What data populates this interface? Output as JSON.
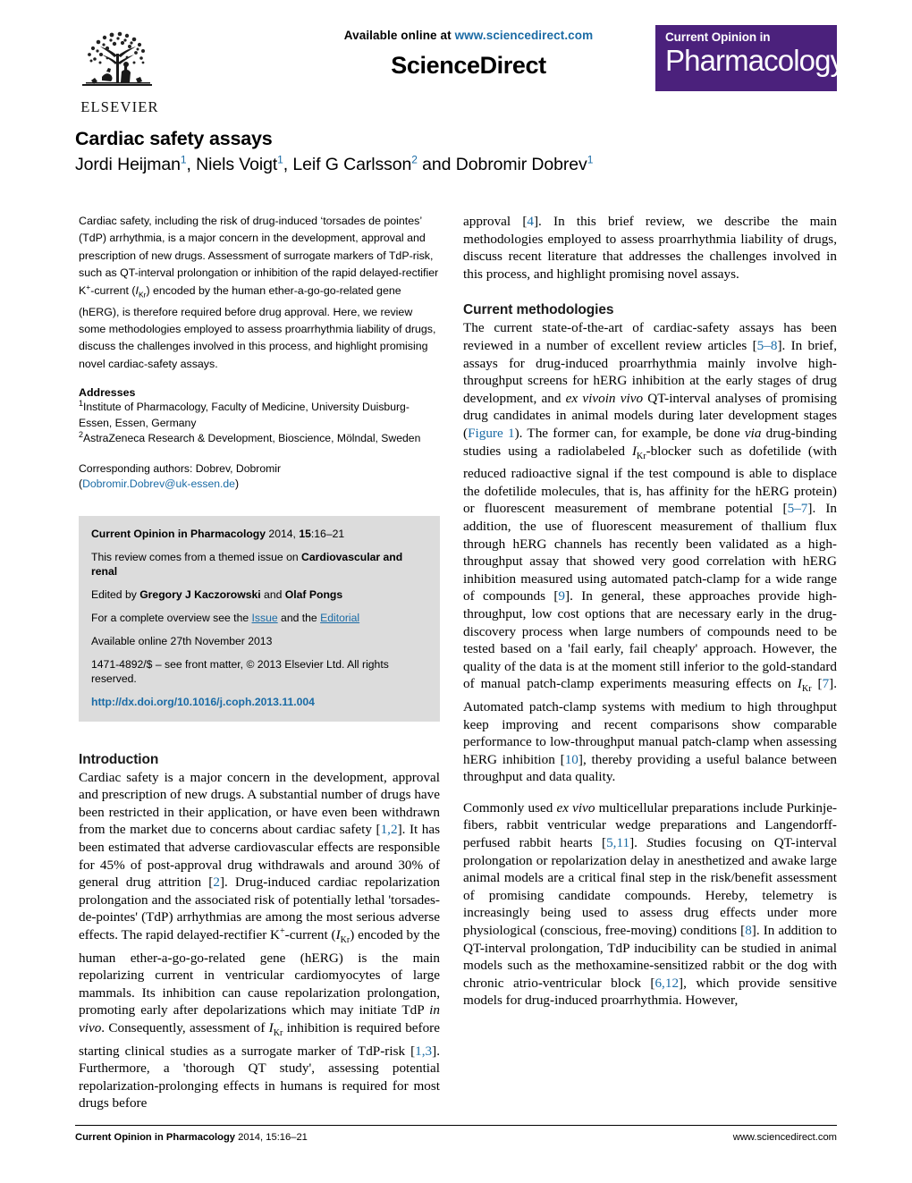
{
  "masthead": {
    "available_online": "Available online at ",
    "sciencedirect_url": "www.sciencedirect.com",
    "sciencedirect_wordmark": "ScienceDirect",
    "elsevier_name": "ELSEVIER",
    "journal_logo_line1": "Current Opinion in",
    "journal_logo_line2": "Pharmacology",
    "journal_logo_color": "#4b217c"
  },
  "article": {
    "title": "Cardiac safety assays",
    "authors": [
      {
        "name": "Jordi Heijman",
        "sup": "1",
        "sep": ", "
      },
      {
        "name": "Niels Voigt",
        "sup": "1",
        "sep": ", "
      },
      {
        "name": "Leif G Carlsson",
        "sup": "2",
        "sep": " and "
      },
      {
        "name": "Dobromir Dobrev",
        "sup": "1",
        "sep": ""
      }
    ]
  },
  "abstract": {
    "text": "Cardiac safety, including the risk of drug-induced 'torsades de pointes' (TdP) arrhythmia, is a major concern in the development, approval and prescription of new drugs. Assessment of surrogate markers of TdP-risk, such as QT-interval prolongation or inhibition of the rapid delayed-rectifier K+-current (IKr) encoded by the human ether-a-go-go-related gene (hERG), is therefore required before drug approval. Here, we review some methodologies employed to assess proarrhythmia liability of drugs, discuss the challenges involved in this process, and highlight promising novel cardiac-safety assays."
  },
  "addresses": {
    "heading": "Addresses",
    "items": [
      {
        "sup": "1",
        "text": "Institute of Pharmacology, Faculty of Medicine, University Duisburg-Essen, Essen, Germany"
      },
      {
        "sup": "2",
        "text": "AstraZeneca Research & Development, Bioscience, Mölndal, Sweden"
      }
    ],
    "corresponding_label": "Corresponding authors: Dobrev, Dobromir",
    "corresponding_email": "Dobromir.Dobrev@uk-essen.de"
  },
  "info_box": {
    "citation_journal": "Current Opinion in Pharmacology",
    "citation_rest": " 2014, ",
    "citation_volume": "15",
    "citation_pages": ":16–21",
    "themed_prefix": "This review comes from a themed issue on ",
    "themed_issue": "Cardiovascular and renal",
    "edited_prefix": "Edited by ",
    "editor_1": "Gregory J Kaczorowski",
    "edited_mid": " and ",
    "editor_2": "Olaf Pongs",
    "overview_prefix": "For a complete overview see the ",
    "overview_link_1": "Issue",
    "overview_mid": " and the ",
    "overview_link_2": "Editorial",
    "available_online": "Available online 27th November 2013",
    "front_matter": "1471-4892/$ – see front matter, © 2013 Elsevier Ltd. All rights reserved.",
    "doi": "http://dx.doi.org/10.1016/j.coph.2013.11.004"
  },
  "sections": {
    "introduction_heading": "Introduction",
    "current_methodologies_heading": "Current methodologies"
  },
  "body": {
    "intro_p1_a": "Cardiac safety is a major concern in the development, approval and prescription of new drugs. A substantial number of drugs have been restricted in their application, or have even been withdrawn from the market due to concerns about cardiac safety [",
    "intro_ref_1": "1,2",
    "intro_p1_b": "]. It has been estimated that adverse cardiovascular effects are responsible for 45% of post-approval drug withdrawals and around 30% of general drug attrition [",
    "intro_ref_2": "2",
    "intro_p1_c": "]. Drug-induced cardiac repolarization prolongation and the associated risk of potentially lethal 'torsades-de-pointes' (TdP) arrhythmias are among the most serious adverse effects. The rapid delayed-rectifier K",
    "intro_p1_d": "-current (",
    "intro_p1_e": ") encoded by the human ether-a-go-go-related gene (hERG) is the main repolarizing current in ventricular cardiomyocytes of large mammals. Its inhibition can cause repolarization prolongation, promoting early after depolarizations which may initiate TdP ",
    "intro_p1_f": "in vivo",
    "intro_p1_g": ". Consequently, assessment of ",
    "intro_p1_h": " inhibition is required before starting clinical studies as a surrogate marker of TdP-risk [",
    "intro_ref_3": "1,3",
    "intro_p1_i": "]. Furthermore, a 'thorough QT study', assessing potential repolarization-prolonging effects in humans is required for most drugs before",
    "right_p1_a": "approval [",
    "right_ref_4": "4",
    "right_p1_b": "]. In this brief review, we describe the main methodologies employed to assess proarrhythmia liability of drugs, discuss recent literature that addresses the challenges involved in this process, and highlight promising novel assays.",
    "meth_p1_a": "The current state-of-the-art of cardiac-safety assays has been reviewed in a number of excellent review articles [",
    "meth_ref_58": "5–8",
    "meth_p1_b": "]. In brief, assays for drug-induced proarrhythmia mainly involve high-throughput screens for hERG inhibition at the early stages of drug development, and ",
    "meth_p1_italic1": "ex vivo",
    "meth_p1_italic1b": "in vivo",
    "meth_p1_c": " QT-interval analyses of promising drug candidates in animal models during later development stages (",
    "meth_figure_link": "Figure 1",
    "meth_p1_d": "). The former can, for example, be done ",
    "meth_p1_via": "via",
    "meth_p1_e": " drug-binding studies using a radiolabeled ",
    "meth_p1_f": "-blocker such as dofetilide (with reduced radioactive signal if the test compound is able to displace the dofetilide molecules, that is, has affinity for the hERG protein) or fluorescent measurement of membrane potential [",
    "meth_ref_57": "5–7",
    "meth_p1_g": "]. In addition, the use of fluorescent measurement of thallium flux through hERG channels has recently been validated as a high-throughput assay that showed very good correlation with hERG inhibition measured using automated patch-clamp for a wide range of compounds [",
    "meth_ref_9": "9",
    "meth_p1_h": "]. In general, these approaches provide high-throughput, low cost options that are necessary early in the drug-discovery process when large numbers of compounds need to be tested based on a 'fail early, fail cheaply' approach. However, the quality of the data is at the moment still inferior to the gold-standard of manual patch-clamp experiments measuring effects on ",
    "meth_p1_i": " [",
    "meth_ref_7": "7",
    "meth_p1_j": "]. Automated patch-clamp systems with medium to high throughput keep improving and recent comparisons show comparable performance to low-throughput manual patch-clamp when assessing hERG inhibition [",
    "meth_ref_10": "10",
    "meth_p1_k": "], thereby providing a useful balance between throughput and data quality.",
    "meth_p2_a": "Commonly used ",
    "meth_p2_exvivo": "ex vivo",
    "meth_p2_b": " multicellular preparations include Purkinje-fibers, rabbit ventricular wedge preparations and Langendorff-perfused rabbit hearts [",
    "meth_ref_511": "5,11",
    "meth_p2_c": "]. ",
    "meth_p2_studies": "S",
    "meth_p2_d": "tudies focusing on QT-interval prolongation or repolarization delay in anesthetized and awake large animal models are a critical final step in the risk/benefit assessment of promising candidate compounds. Hereby, telemetry is increasingly being used to assess drug effects under more physiological (conscious, free-moving) conditions [",
    "meth_ref_8": "8",
    "meth_p2_e": "]. In addition to QT-interval prolongation, TdP inducibility can be studied in animal models such as the methoxamine-sensitized rabbit or the dog with chronic atrio-ventricular block [",
    "meth_ref_612": "6,12",
    "meth_p2_f": "], which provide sensitive models for drug-induced proarrhythmia. However,"
  },
  "footer": {
    "left_journal": "Current Opinion in Pharmacology",
    "left_rest": " 2014, 15:16–21",
    "right": "www.sciencedirect.com"
  }
}
